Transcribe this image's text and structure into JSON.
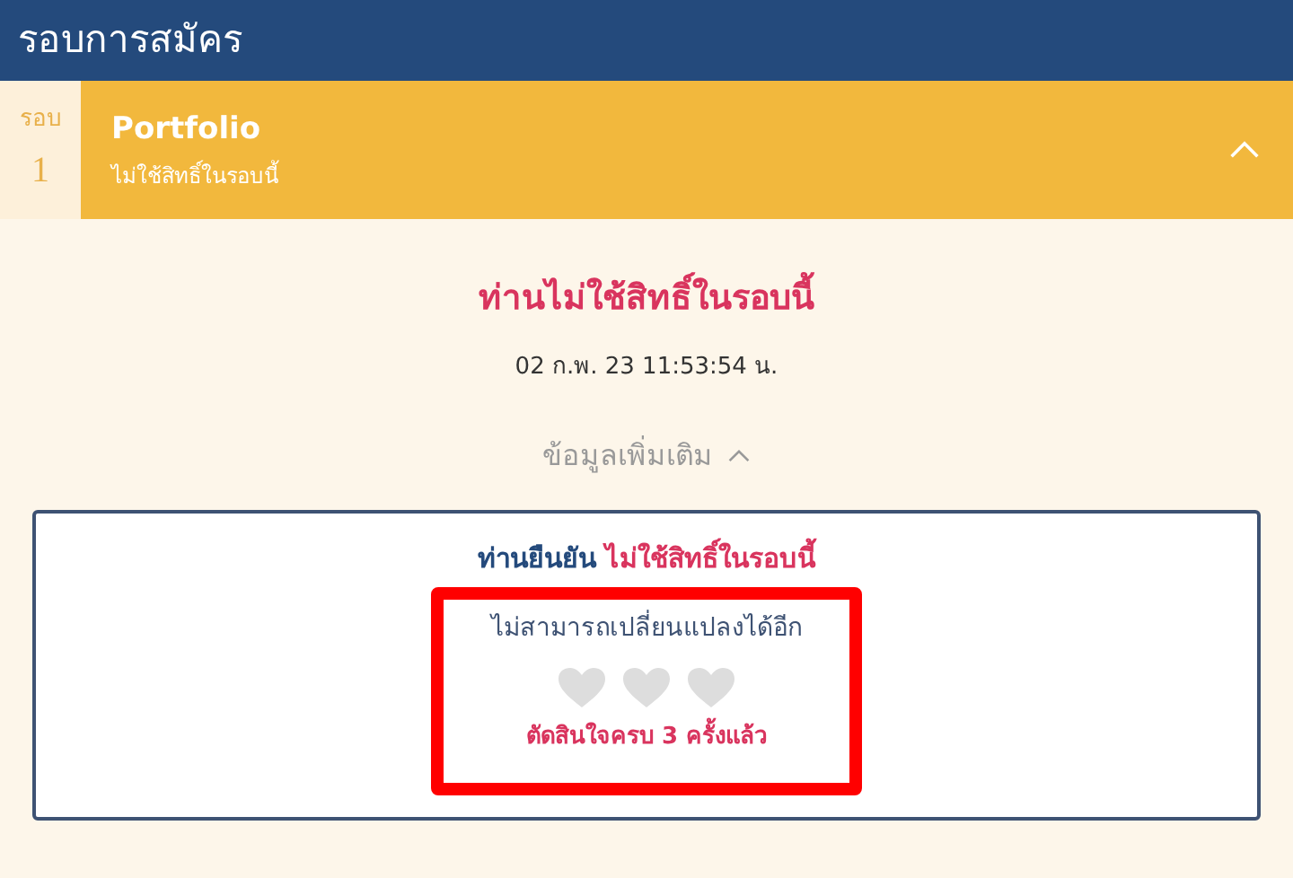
{
  "header": {
    "title": "รอบการสมัคร"
  },
  "round": {
    "label": "รอบ",
    "number": "1",
    "title": "Portfolio",
    "subtitle": "ไม่ใช้สิทธิ์ในรอบนี้",
    "expanded": true
  },
  "status": {
    "title": "ท่านไม่ใช้สิทธิ์ในรอบนี้",
    "timestamp": "02 ก.พ. 23 11:53:54 น.",
    "more_info": "ข้อมูลเพิ่มเติม",
    "more_info_expanded": true
  },
  "card": {
    "confirm_prefix": "ท่านยืนยัน",
    "confirm_choice": "ไม่ใช้สิทธิ์ในรอบนี้",
    "notice": "ไม่สามารถเปลี่ยนแปลงได้อีก",
    "hearts": [
      {
        "filled": false
      },
      {
        "filled": false
      },
      {
        "filled": false
      }
    ],
    "count_text": "ตัดสินใจครบ 3 ครั้งแล้ว",
    "highlighted": true
  }
}
